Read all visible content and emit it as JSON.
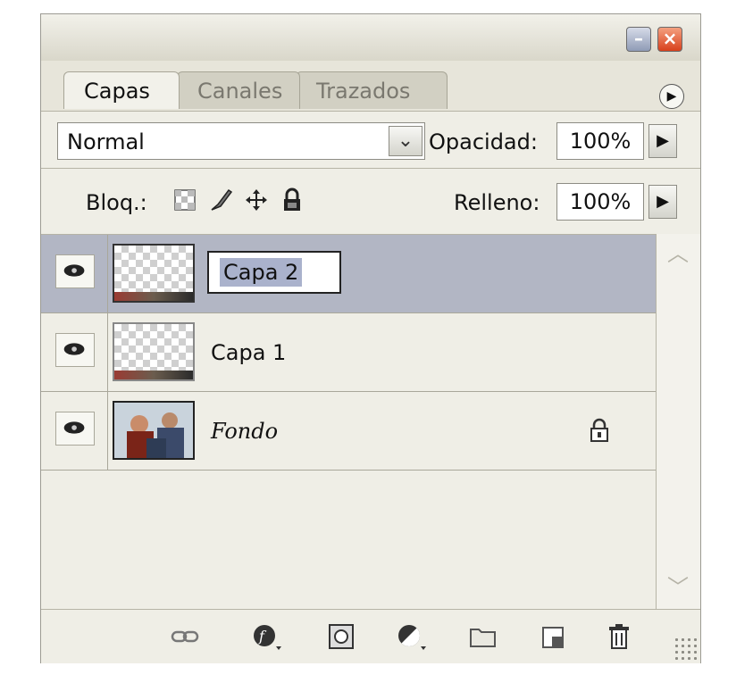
{
  "tabs": {
    "layers": "Capas",
    "channels": "Canales",
    "paths": "Trazados"
  },
  "blend": {
    "mode": "Normal",
    "opacity_label": "Opacidad:",
    "opacity_value": "100%"
  },
  "lock": {
    "label": "Bloq.:",
    "fill_label": "Relleno:",
    "fill_value": "100%"
  },
  "layers": [
    {
      "name": "Capa 2",
      "selected": true,
      "editing": true
    },
    {
      "name": "Capa 1",
      "selected": false
    },
    {
      "name": "Fondo",
      "selected": false,
      "locked": true
    }
  ],
  "colors": {
    "selected_row": "#b2b6c4",
    "panel_bg": "#ece9d8",
    "close_button": "#d8401c"
  },
  "icons": {
    "title_bar": [
      "minimize-icon",
      "close-icon"
    ],
    "lock_options": [
      "lock-transparency-icon",
      "lock-paint-icon",
      "lock-move-icon",
      "lock-all-icon"
    ],
    "bottom_toolbar": [
      "link-layers-icon",
      "layer-style-icon",
      "layer-mask-icon",
      "adjustment-layer-icon",
      "new-group-icon",
      "new-layer-icon",
      "trash-icon"
    ]
  }
}
